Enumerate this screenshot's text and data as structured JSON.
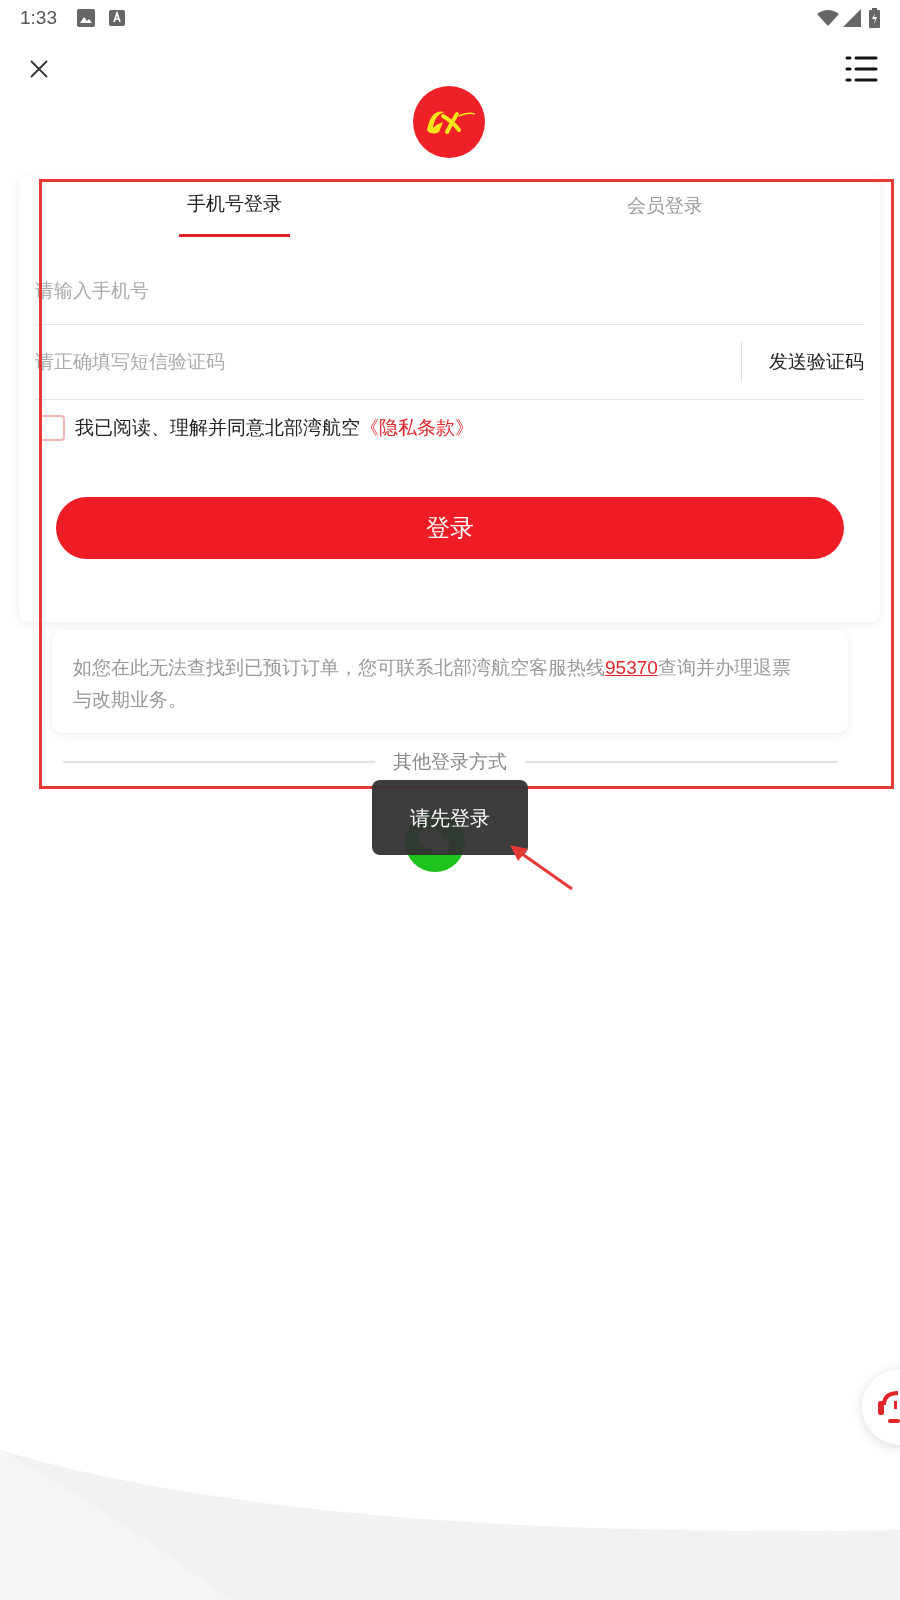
{
  "status_bar": {
    "time": "1:33"
  },
  "tabs": [
    {
      "label": "手机号登录",
      "selected": true
    },
    {
      "label": "会员登录",
      "selected": false
    }
  ],
  "phone_field": {
    "placeholder": "请输入手机号"
  },
  "code_field": {
    "placeholder": "请正确填写短信验证码"
  },
  "send_code_button": "发送验证码",
  "agreement": {
    "checked": false,
    "text": "我已阅读、理解并同意北部湾航空",
    "link": "《隐私条款》"
  },
  "login_button": "登录",
  "notice": {
    "before": "如您在此无法查找到已预订订单，您可联系北部湾航空客服热线",
    "hotline": "95370",
    "after": "查询并办理退票与改期业务。"
  },
  "other_login": "其他登录方式",
  "toast": "请先登录"
}
